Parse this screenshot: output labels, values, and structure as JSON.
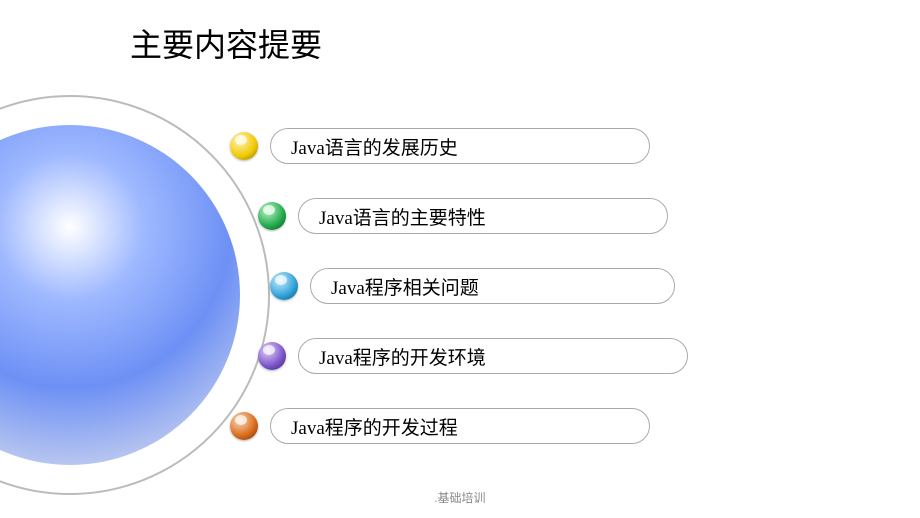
{
  "title": "主要内容提要",
  "footer": ".基础培训",
  "items": [
    {
      "label": "Java语言的发展历史",
      "color": "yellow"
    },
    {
      "label": "Java语言的主要特性",
      "color": "green"
    },
    {
      "label": "Java程序相关问题",
      "color": "cyan"
    },
    {
      "label": "Java程序的开发环境",
      "color": "purple"
    },
    {
      "label": "Java程序的开发过程",
      "color": "orange"
    }
  ]
}
